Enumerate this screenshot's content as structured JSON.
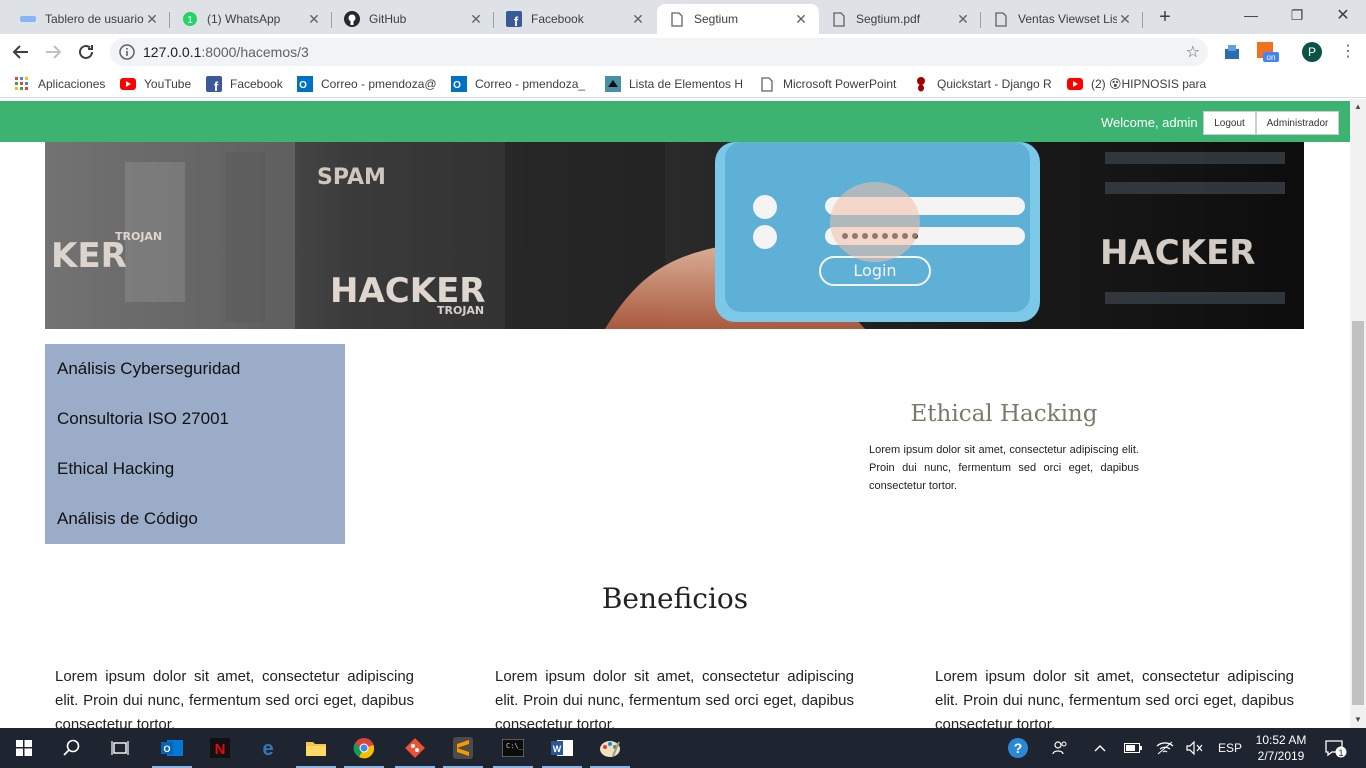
{
  "browser": {
    "tabs": [
      {
        "label": "Tablero de usuario",
        "icon": "dashboard-icon"
      },
      {
        "label": "(1) WhatsApp",
        "icon": "whatsapp-icon"
      },
      {
        "label": "GitHub",
        "icon": "github-icon"
      },
      {
        "label": "Facebook",
        "icon": "facebook-icon"
      },
      {
        "label": "Segtium",
        "icon": "page-icon",
        "active": true
      },
      {
        "label": "Segtium.pdf",
        "icon": "page-icon"
      },
      {
        "label": "Ventas Viewset Lis",
        "icon": "page-icon"
      }
    ],
    "url_host": "127.0.0.1",
    "url_path": ":8000/hacemos/3",
    "profile_initial": "P",
    "bookmarks": [
      {
        "label": "Aplicaciones",
        "icon": "apps-grid-icon"
      },
      {
        "label": "YouTube",
        "icon": "youtube-icon"
      },
      {
        "label": "Facebook",
        "icon": "facebook-icon"
      },
      {
        "label": "Correo - pmendoza@",
        "icon": "outlook-icon"
      },
      {
        "label": "Correo - pmendoza_",
        "icon": "outlook-icon"
      },
      {
        "label": "Lista de Elementos H",
        "icon": "bird-icon"
      },
      {
        "label": "Microsoft PowerPoint",
        "icon": "page-icon"
      },
      {
        "label": "Quickstart - Django R",
        "icon": "django-icon"
      },
      {
        "label": "(2) 😵HIPNOSIS para",
        "icon": "youtube-icon"
      }
    ]
  },
  "site": {
    "welcome": "Welcome, admin",
    "logout": "Logout",
    "admin": "Administrador",
    "banner_words": [
      "SPAM",
      "TROJAN",
      "KER",
      "HACKER",
      "TROJAN",
      "HACKER",
      "Login"
    ],
    "menu": [
      "Análisis Cyberseguridad",
      "Consultoria ISO 27001",
      "Ethical Hacking",
      "Análisis de Código"
    ],
    "service_title": "Ethical Hacking",
    "service_desc": "Lorem ipsum dolor sit amet, consectetur adipiscing elit. Proin dui nunc, fermentum sed orci eget, dapibus consectetur tortor.",
    "benefits_title": "Beneficios",
    "benefits": [
      "Lorem ipsum dolor sit amet, consectetur adipiscing elit. Proin dui nunc, fermentum sed orci eget, dapibus consectetur tortor.",
      "Lorem ipsum dolor sit amet, consectetur adipiscing elit. Proin dui nunc, fermentum sed orci eget, dapibus consectetur tortor.",
      "Lorem ipsum dolor sit amet, consectetur adipiscing elit. Proin dui nunc, fermentum sed orci eget, dapibus consectetur tortor."
    ]
  },
  "taskbar": {
    "language": "ESP",
    "time": "10:52 AM",
    "date": "2/7/2019",
    "notification_count": "1"
  },
  "colors": {
    "topbar": "#3cb371",
    "sidemenu": "#9aacc8",
    "service_title": "#7a7a6a"
  }
}
